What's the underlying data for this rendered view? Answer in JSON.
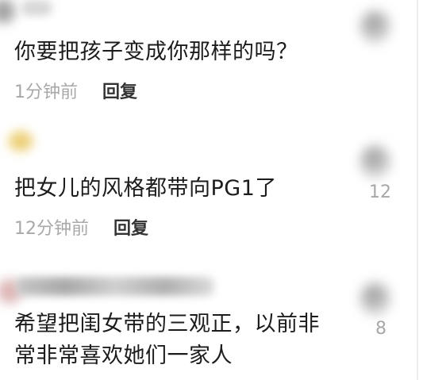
{
  "comments": [
    {
      "text": "你要把孩子变成你那样的吗？",
      "time": "1分钟前",
      "reply_label": "回复",
      "likes": ""
    },
    {
      "text": "把女儿的风格都带向PG1了",
      "time": "12分钟前",
      "reply_label": "回复",
      "likes": "12"
    },
    {
      "text_line1": "希望把闺女带的三观正，以前非",
      "text_line2": "常非常喜欢她们一家人",
      "likes": "8"
    }
  ]
}
